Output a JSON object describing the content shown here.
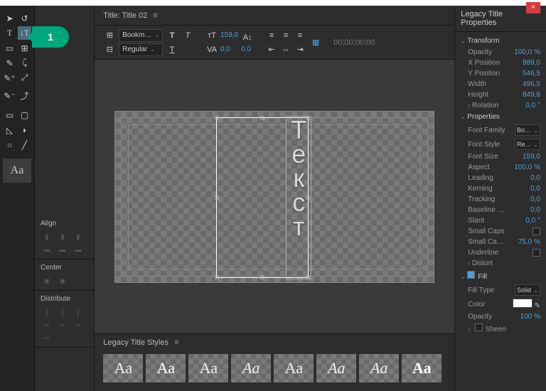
{
  "header": {
    "title": "Title: Title 02",
    "close": "×"
  },
  "badge": "1",
  "toolbar": {
    "font": "Bookm…",
    "style": "Regular",
    "size": "159,0",
    "kerning": "0,0",
    "timecode": "00;00;00;00"
  },
  "canvas": {
    "text": "Текст"
  },
  "styles": {
    "title": "Legacy Title Styles",
    "label": "Aa"
  },
  "panels": {
    "align": "Align",
    "center": "Center",
    "distribute": "Distribute"
  },
  "props": {
    "title": "Legacy Title Properties",
    "transform": {
      "h": "Transform",
      "opacity_l": "Opacity",
      "opacity": "100,0 %",
      "xpos_l": "X Position",
      "xpos": "889,0",
      "ypos_l": "Y Position",
      "ypos": "546,5",
      "width_l": "Width",
      "width": "496,5",
      "height_l": "Height",
      "height": "849,8",
      "rot_l": "Rotation",
      "rot": "0,0 °"
    },
    "properties": {
      "h": "Properties",
      "ff_l": "Font Family",
      "ff": "Bo…",
      "fs_l": "Font Style",
      "fs": "Re…",
      "size_l": "Font Size",
      "size": "159,0",
      "aspect_l": "Aspect",
      "aspect": "100,0 %",
      "lead_l": "Leading",
      "lead": "0,0",
      "kern_l": "Kerning",
      "kern": "0,0",
      "track_l": "Tracking",
      "track": "0,0",
      "base_l": "Baseline …",
      "base": "0,0",
      "slant_l": "Slant",
      "slant": "0,0 °",
      "scaps_l": "Small Caps",
      "scapsz_l": "Small Ca…",
      "scapsz": "75,0 %",
      "under_l": "Underline",
      "distort_l": "Distort"
    },
    "fill": {
      "h": "Fill",
      "type_l": "Fill Type",
      "type": "Solid",
      "color_l": "Color",
      "opacity_l": "Opacity",
      "opacity": "100 %",
      "sheen_l": "Sheen"
    }
  }
}
